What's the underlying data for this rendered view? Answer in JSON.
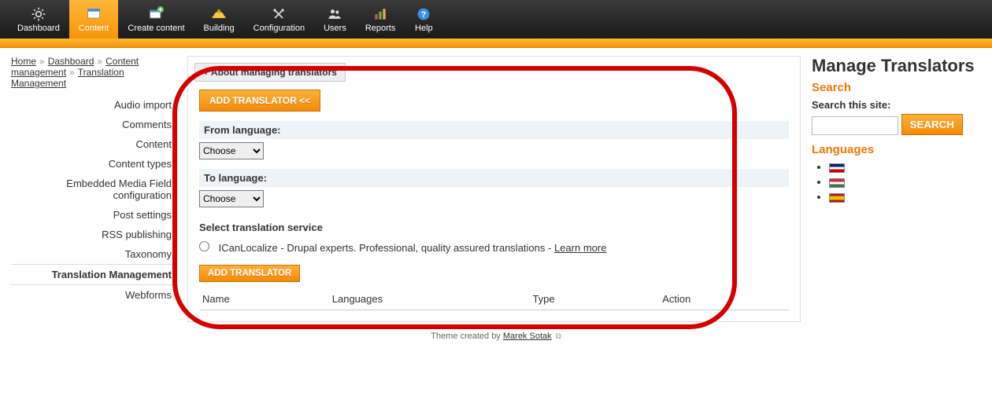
{
  "topnav": [
    {
      "label": "Dashboard",
      "icon": "gear"
    },
    {
      "label": "Content",
      "icon": "window",
      "active": true
    },
    {
      "label": "Create content",
      "icon": "window-plus"
    },
    {
      "label": "Building",
      "icon": "helmet"
    },
    {
      "label": "Configuration",
      "icon": "tools"
    },
    {
      "label": "Users",
      "icon": "people"
    },
    {
      "label": "Reports",
      "icon": "bars"
    },
    {
      "label": "Help",
      "icon": "question"
    }
  ],
  "breadcrumb": [
    {
      "label": "Home"
    },
    {
      "label": "Dashboard"
    },
    {
      "label": "Content management"
    },
    {
      "label": "Translation Management"
    }
  ],
  "breadcrumb_sep": "»",
  "leftmenu": [
    {
      "label": "Audio import"
    },
    {
      "label": "Comments"
    },
    {
      "label": "Content"
    },
    {
      "label": "Content types"
    },
    {
      "label": "Embedded Media Field configuration"
    },
    {
      "label": "Post settings"
    },
    {
      "label": "RSS publishing"
    },
    {
      "label": "Taxonomy"
    },
    {
      "label": "Translation Management",
      "active": true
    },
    {
      "label": "Webforms"
    }
  ],
  "panel": {
    "collapse_label": "About managing translators",
    "collapse_prefix": "+",
    "add_translator_btn_top": "ADD TRANSLATOR <<",
    "from_label": "From language:",
    "to_label": "To language:",
    "choose_option": "Choose",
    "service_label": "Select translation service",
    "service_option": "ICanLocalize - Drupal experts. Professional, quality assured translations -",
    "learn_more": "Learn more",
    "add_translator_btn_bottom": "ADD TRANSLATOR",
    "table_headers": [
      "Name",
      "Languages",
      "Type",
      "Action"
    ]
  },
  "page_title": "Manage Translators",
  "sidebar": {
    "search_head": "Search",
    "search_label": "Search this site:",
    "search_btn": "SEARCH",
    "languages_head": "Languages"
  },
  "footer": {
    "prefix": "Theme created by ",
    "author": "Marek Sotak"
  }
}
